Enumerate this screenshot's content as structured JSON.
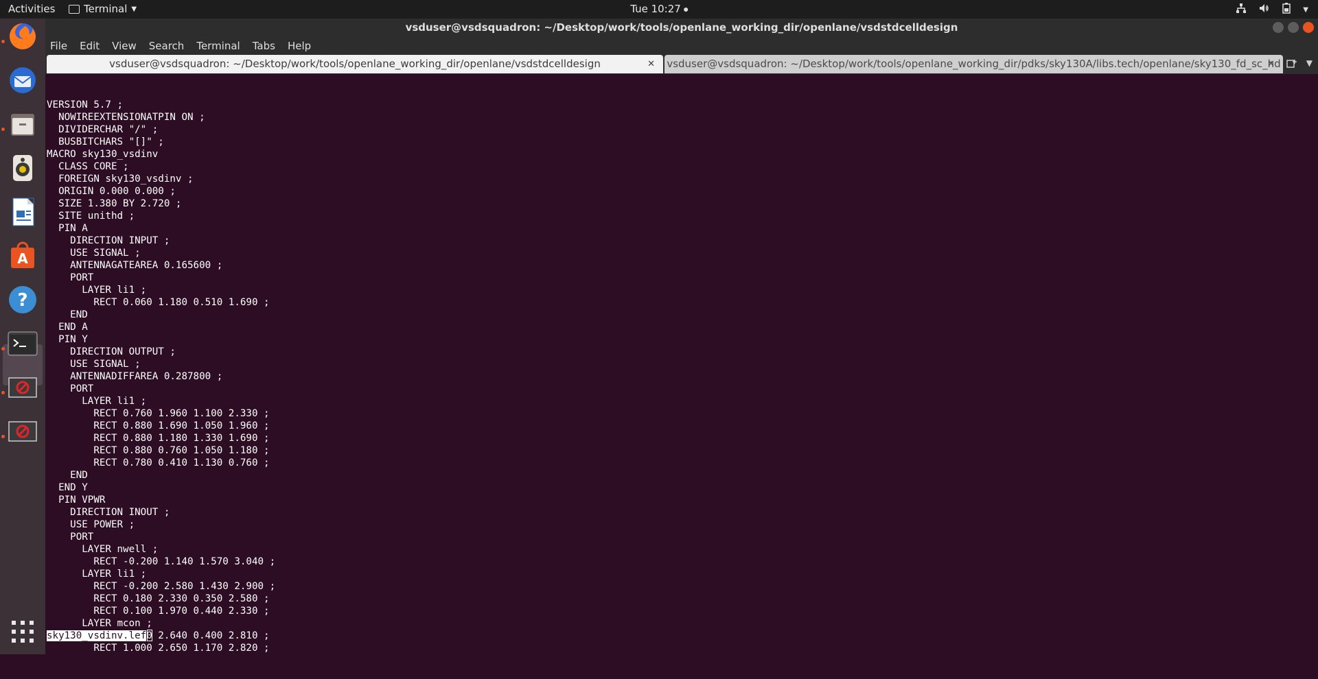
{
  "topbar": {
    "activities": "Activities",
    "app_name": "Terminal",
    "clock": "Tue 10:27"
  },
  "window": {
    "title": "vsduser@vsdsquadron: ~/Desktop/work/tools/openlane_working_dir/openlane/vsdstdcelldesign"
  },
  "menu": [
    "File",
    "Edit",
    "View",
    "Search",
    "Terminal",
    "Tabs",
    "Help"
  ],
  "tabs": [
    {
      "label": "vsduser@vsdsquadron: ~/Desktop/work/tools/openlane_working_dir/openlane/vsdstdcelldesign",
      "active": true
    },
    {
      "label": "vsduser@vsdsquadron: ~/Desktop/work/tools/openlane_working_dir/pdks/sky130A/libs.tech/openlane/sky130_fd_sc_hd",
      "active": false
    }
  ],
  "dock": [
    "firefox-icon",
    "thunderbird-icon",
    "files-icon",
    "rhythmbox-icon",
    "writer-icon",
    "software-center-icon",
    "help-icon",
    "terminal-icon",
    "blocked-app-icon",
    "blocked-app-icon"
  ],
  "terminal": {
    "lines": [
      "VERSION 5.7 ;",
      "  NOWIREEXTENSIONATPIN ON ;",
      "  DIVIDERCHAR \"/\" ;",
      "  BUSBITCHARS \"[]\" ;",
      "MACRO sky130_vsdinv",
      "  CLASS CORE ;",
      "  FOREIGN sky130_vsdinv ;",
      "  ORIGIN 0.000 0.000 ;",
      "  SIZE 1.380 BY 2.720 ;",
      "  SITE unithd ;",
      "  PIN A",
      "    DIRECTION INPUT ;",
      "    USE SIGNAL ;",
      "    ANTENNAGATEAREA 0.165600 ;",
      "    PORT",
      "      LAYER li1 ;",
      "        RECT 0.060 1.180 0.510 1.690 ;",
      "    END",
      "  END A",
      "  PIN Y",
      "    DIRECTION OUTPUT ;",
      "    USE SIGNAL ;",
      "    ANTENNADIFFAREA 0.287800 ;",
      "    PORT",
      "      LAYER li1 ;",
      "        RECT 0.760 1.960 1.100 2.330 ;",
      "        RECT 0.880 1.690 1.050 1.960 ;",
      "        RECT 0.880 1.180 1.330 1.690 ;",
      "        RECT 0.880 0.760 1.050 1.180 ;",
      "        RECT 0.780 0.410 1.130 0.760 ;",
      "    END",
      "  END Y",
      "  PIN VPWR",
      "    DIRECTION INOUT ;",
      "    USE POWER ;",
      "    PORT",
      "      LAYER nwell ;",
      "        RECT -0.200 1.140 1.570 3.040 ;",
      "      LAYER li1 ;",
      "        RECT -0.200 2.580 1.430 2.900 ;",
      "        RECT 0.180 2.330 0.350 2.580 ;",
      "        RECT 0.100 1.970 0.440 2.330 ;",
      "      LAYER mcon ;",
      "        RECT 0.230 2.640 0.400 2.810 ;",
      "        RECT 1.000 2.650 1.170 2.820 ;"
    ],
    "status": "sky130_vsdinv.lef"
  }
}
